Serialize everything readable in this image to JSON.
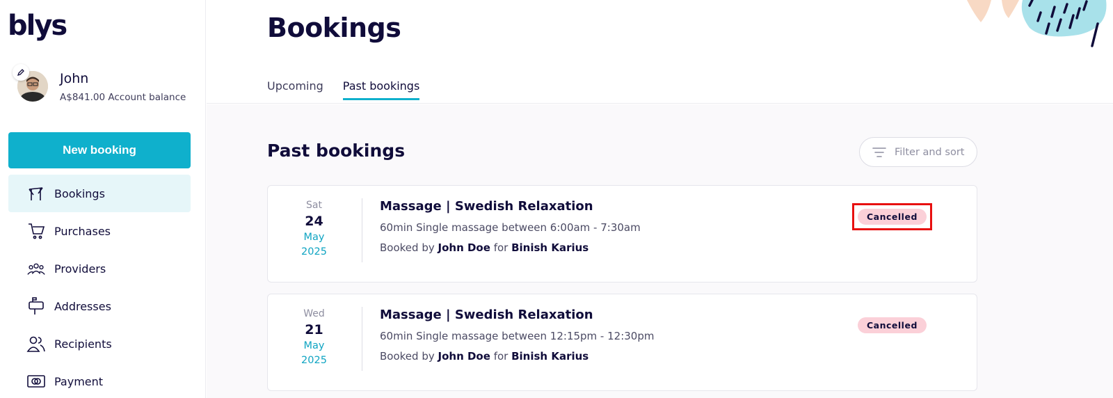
{
  "brand": {
    "logo": "blys",
    "accent": "#0fb0cc"
  },
  "profile": {
    "name": "John",
    "balance": "A$841.00 Account balance"
  },
  "sidebar": {
    "new_booking_label": "New booking",
    "items": [
      {
        "label": "Bookings",
        "icon": "bookings-icon",
        "active": true
      },
      {
        "label": "Purchases",
        "icon": "cart-icon"
      },
      {
        "label": "Providers",
        "icon": "providers-icon"
      },
      {
        "label": "Addresses",
        "icon": "mailbox-icon"
      },
      {
        "label": "Recipients",
        "icon": "recipients-icon"
      },
      {
        "label": "Payment",
        "icon": "card-icon"
      }
    ]
  },
  "header": {
    "title": "Bookings",
    "tabs": [
      {
        "label": "Upcoming",
        "active": false
      },
      {
        "label": "Past bookings",
        "active": true
      }
    ]
  },
  "main": {
    "section_title": "Past bookings",
    "filter_label": "Filter and sort",
    "bookings": [
      {
        "dow": "Sat",
        "day": "24",
        "month": "May",
        "year": "2025",
        "title": "Massage | Swedish Relaxation",
        "description": "60min Single massage between 6:00am - 7:30am",
        "booked_by_prefix": "Booked by",
        "booked_by": "John Doe",
        "for_word": "for",
        "recipient": "Binish Karius",
        "status": "Cancelled"
      },
      {
        "dow": "Wed",
        "day": "21",
        "month": "May",
        "year": "2025",
        "title": "Massage | Swedish Relaxation",
        "description": "60min Single massage between 12:15pm - 12:30pm",
        "booked_by_prefix": "Booked by",
        "booked_by": "John Doe",
        "for_word": "for",
        "recipient": "Binish Karius",
        "status": "Cancelled"
      }
    ]
  }
}
